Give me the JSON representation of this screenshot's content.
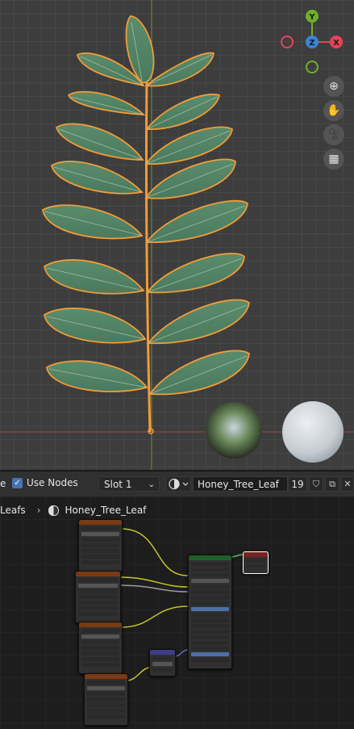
{
  "viewport": {
    "gizmo": {
      "x_label": "X",
      "y_label": "Y",
      "z_label": "Z"
    },
    "nav_buttons": [
      {
        "name": "zoom",
        "glyph": "⊕"
      },
      {
        "name": "pan",
        "glyph": "✋"
      },
      {
        "name": "camera",
        "glyph": "🎥"
      },
      {
        "name": "ortho-grid",
        "glyph": "▦"
      }
    ]
  },
  "header": {
    "left_clip_text": "e",
    "use_nodes_label": "Use Nodes",
    "slot_label": "Slot 1",
    "material_name": "Honey_Tree_Leaf",
    "users_count": "19"
  },
  "node_editor": {
    "breadcrumb_parent": "Leafs",
    "breadcrumb_material": "Honey_Tree_Leaf"
  },
  "colors": {
    "selection_outline": "#f29c38",
    "leaf_fill": "#4f7f62",
    "image_node_header": "#7a3a12",
    "bsdf_node_header": "#1f5f2a",
    "output_node_header": "#7a2222",
    "link_yellow": "#c7c32a",
    "link_gray": "#9c9c9c",
    "link_blue": "#6363c7",
    "x_axis": "#e64455",
    "y_axis": "#6db02b",
    "z_axis": "#3b83d9"
  }
}
